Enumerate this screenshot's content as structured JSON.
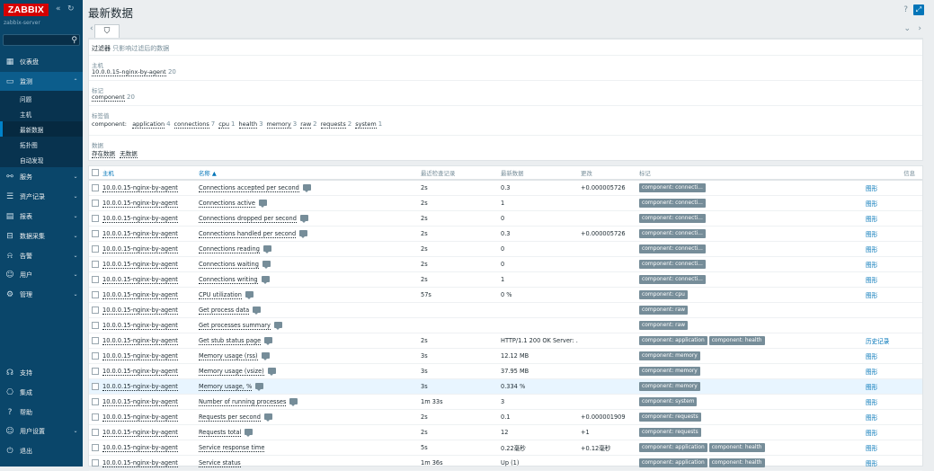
{
  "app": {
    "logo": "ZABBIX",
    "server": "zabbix-server",
    "search_placeholder": ""
  },
  "nav": [
    {
      "label": "仪表盘",
      "icon": "dashboard-icon"
    },
    {
      "label": "监测",
      "icon": "monitor-icon"
    },
    {
      "label": "服务",
      "icon": "services-icon"
    },
    {
      "label": "资产记录",
      "icon": "inventory-icon"
    },
    {
      "label": "报表",
      "icon": "reports-icon"
    },
    {
      "label": "数据采集",
      "icon": "data-collection-icon"
    },
    {
      "label": "告警",
      "icon": "alerts-icon"
    },
    {
      "label": "用户",
      "icon": "users-icon"
    },
    {
      "label": "管理",
      "icon": "admin-icon"
    }
  ],
  "subnav": [
    "问题",
    "主机",
    "最新数据",
    "拓扑图",
    "自动发现"
  ],
  "bottom_nav": [
    "支持",
    "集成",
    "帮助",
    "用户设置",
    "退出"
  ],
  "page": {
    "title": "最新数据",
    "help": "?"
  },
  "filter": {
    "tab_label": "过滤器",
    "note": "只影响过滤后的数据",
    "host_label": "主机",
    "host_value": "10.0.0.15-nginx-by-agent",
    "host_count": "20",
    "tag_label": "标记",
    "tag_value": "component",
    "tag_count": "20",
    "tagval_label": "标签值",
    "tagval_prefix": "component:",
    "tagvals": [
      {
        "name": "application",
        "count": "4"
      },
      {
        "name": "connections",
        "count": "7"
      },
      {
        "name": "cpu",
        "count": "1"
      },
      {
        "name": "health",
        "count": "3"
      },
      {
        "name": "memory",
        "count": "3"
      },
      {
        "name": "raw",
        "count": "2"
      },
      {
        "name": "requests",
        "count": "2"
      },
      {
        "name": "system",
        "count": "1"
      }
    ],
    "data_label": "数据",
    "data_with": "存在数据",
    "data_without": "无数据"
  },
  "table": {
    "headers": {
      "host": "主机",
      "name": "名称 ▲",
      "lastcheck": "最近检查记录",
      "lastvalue": "最新数据",
      "change": "更改",
      "tags": "标记",
      "info": "信息"
    },
    "rows": [
      {
        "host": "10.0.0.15-nginx-by-agent",
        "name": "Connections accepted per second",
        "cmt": true,
        "lastcheck": "2s",
        "value": "0.3",
        "change": "+0.000005726",
        "tags": [
          "component: connecti..."
        ],
        "action": "图形"
      },
      {
        "host": "10.0.0.15-nginx-by-agent",
        "name": "Connections active",
        "cmt": true,
        "lastcheck": "2s",
        "value": "1",
        "change": "",
        "tags": [
          "component: connecti..."
        ],
        "action": "图形"
      },
      {
        "host": "10.0.0.15-nginx-by-agent",
        "name": "Connections dropped per second",
        "cmt": true,
        "lastcheck": "2s",
        "value": "0",
        "change": "",
        "tags": [
          "component: connecti..."
        ],
        "action": "图形"
      },
      {
        "host": "10.0.0.15-nginx-by-agent",
        "name": "Connections handled per second",
        "cmt": true,
        "lastcheck": "2s",
        "value": "0.3",
        "change": "+0.000005726",
        "tags": [
          "component: connecti..."
        ],
        "action": "图形"
      },
      {
        "host": "10.0.0.15-nginx-by-agent",
        "name": "Connections reading",
        "cmt": true,
        "lastcheck": "2s",
        "value": "0",
        "change": "",
        "tags": [
          "component: connecti..."
        ],
        "action": "图形"
      },
      {
        "host": "10.0.0.15-nginx-by-agent",
        "name": "Connections waiting",
        "cmt": true,
        "lastcheck": "2s",
        "value": "0",
        "change": "",
        "tags": [
          "component: connecti..."
        ],
        "action": "图形"
      },
      {
        "host": "10.0.0.15-nginx-by-agent",
        "name": "Connections writing",
        "cmt": true,
        "lastcheck": "2s",
        "value": "1",
        "change": "",
        "tags": [
          "component: connecti..."
        ],
        "action": "图形"
      },
      {
        "host": "10.0.0.15-nginx-by-agent",
        "name": "CPU utilization",
        "cmt": true,
        "lastcheck": "57s",
        "value": "0 %",
        "change": "",
        "tags": [
          "component: cpu"
        ],
        "action": "图形"
      },
      {
        "host": "10.0.0.15-nginx-by-agent",
        "name": "Get process data",
        "cmt": true,
        "lastcheck": "",
        "value": "",
        "change": "",
        "tags": [
          "component: raw"
        ],
        "action": ""
      },
      {
        "host": "10.0.0.15-nginx-by-agent",
        "name": "Get processes summary",
        "cmt": true,
        "lastcheck": "",
        "value": "",
        "change": "",
        "tags": [
          "component: raw"
        ],
        "action": ""
      },
      {
        "host": "10.0.0.15-nginx-by-agent",
        "name": "Get stub status page",
        "cmt": true,
        "lastcheck": "2s",
        "value": "HTTP/1.1 200 OK Server: ...",
        "change": "",
        "tags": [
          "component: application",
          "component: health"
        ],
        "action": "历史记录"
      },
      {
        "host": "10.0.0.15-nginx-by-agent",
        "name": "Memory usage (rss)",
        "cmt": true,
        "lastcheck": "3s",
        "value": "12.12 MB",
        "change": "",
        "tags": [
          "component: memory"
        ],
        "action": "图形"
      },
      {
        "host": "10.0.0.15-nginx-by-agent",
        "name": "Memory usage (vsize)",
        "cmt": true,
        "lastcheck": "3s",
        "value": "37.95 MB",
        "change": "",
        "tags": [
          "component: memory"
        ],
        "action": "图形"
      },
      {
        "host": "10.0.0.15-nginx-by-agent",
        "name": "Memory usage, %",
        "cmt": true,
        "lastcheck": "3s",
        "value": "0.334 %",
        "change": "",
        "tags": [
          "component: memory"
        ],
        "action": "图形",
        "hover": true
      },
      {
        "host": "10.0.0.15-nginx-by-agent",
        "name": "Number of running processes",
        "cmt": true,
        "lastcheck": "1m 33s",
        "value": "3",
        "change": "",
        "tags": [
          "component: system"
        ],
        "action": "图形"
      },
      {
        "host": "10.0.0.15-nginx-by-agent",
        "name": "Requests per second",
        "cmt": true,
        "lastcheck": "2s",
        "value": "0.1",
        "change": "+0.000001909",
        "tags": [
          "component: requests"
        ],
        "action": "图形"
      },
      {
        "host": "10.0.0.15-nginx-by-agent",
        "name": "Requests total",
        "cmt": true,
        "lastcheck": "2s",
        "value": "12",
        "change": "+1",
        "tags": [
          "component: requests"
        ],
        "action": "图形"
      },
      {
        "host": "10.0.0.15-nginx-by-agent",
        "name": "Service response time",
        "cmt": false,
        "lastcheck": "5s",
        "value": "0.22毫秒",
        "change": "+0.12毫秒",
        "tags": [
          "component: application",
          "component: health"
        ],
        "action": "图形"
      },
      {
        "host": "10.0.0.15-nginx-by-agent",
        "name": "Service status",
        "cmt": false,
        "lastcheck": "1m 36s",
        "value": "Up (1)",
        "change": "",
        "tags": [
          "component: application",
          "component: health"
        ],
        "action": "图形"
      }
    ]
  }
}
